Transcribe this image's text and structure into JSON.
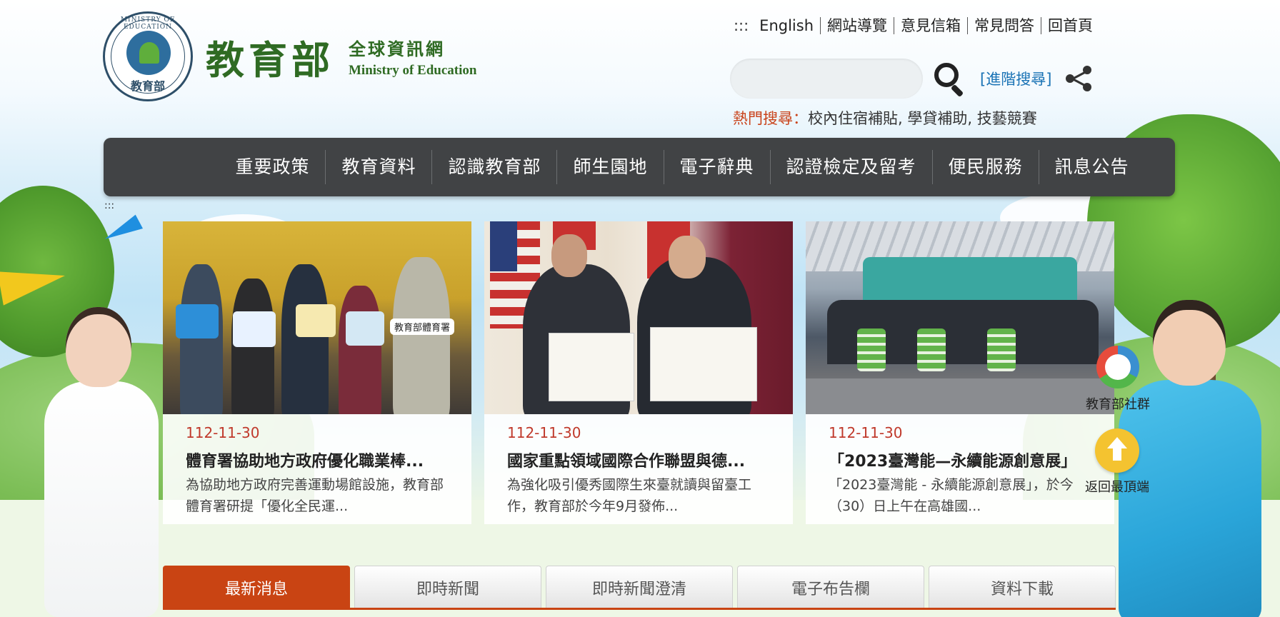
{
  "header": {
    "seal_text": "教育部",
    "seal_arc": "MINISTRY OF EDUCATION",
    "brand_cn": "教育部",
    "brand_sub_cn": "全球資訊網",
    "brand_sub_en": "Ministry of Education"
  },
  "toplinks": {
    "accesskey": ":::",
    "items": [
      "English",
      "網站導覽",
      "意見信箱",
      "常見問答",
      "回首頁"
    ]
  },
  "search": {
    "placeholder": "",
    "advanced_label": "[進階搜尋]"
  },
  "hot_search": {
    "label": "熱門搜尋：",
    "items": [
      "校內住宿補貼",
      "學貸補助",
      "技藝競賽"
    ],
    "separator": ", "
  },
  "mainnav": {
    "items": [
      "重要政策",
      "教育資料",
      "認識教育部",
      "師生園地",
      "電子辭典",
      "認證檢定及留考",
      "便民服務",
      "訊息公告"
    ]
  },
  "accesskey_main": ":::",
  "photo_captions": {
    "card1_sign": "教育部體育署"
  },
  "cards": [
    {
      "date": "112-11-30",
      "title": "體育署協助地方政府優化職業棒...",
      "desc": "為協助地方政府完善運動場館設施，教育部體育署研提「優化全民運..."
    },
    {
      "date": "112-11-30",
      "title": "國家重點領域國際合作聯盟與德...",
      "desc": "為強化吸引優秀國際生來臺就讀與留臺工作，教育部於今年9月發佈..."
    },
    {
      "date": "112-11-30",
      "title": "「2023臺灣能—永續能源創意展」",
      "desc": "「2023臺灣能 - 永續能源創意展」，於今（30）日上午在高雄國..."
    }
  ],
  "floating": {
    "social_label": "教育部社群",
    "top_label": "返回最頂端"
  },
  "tabs": [
    "最新消息",
    "即時新聞",
    "即時新聞澄清",
    "電子布告欄",
    "資料下載"
  ],
  "colors": {
    "nav_bg": "#414345",
    "accent": "#c94413",
    "date": "#c0392b",
    "brand_green": "#2f6b23",
    "link_blue": "#1a73b5"
  }
}
